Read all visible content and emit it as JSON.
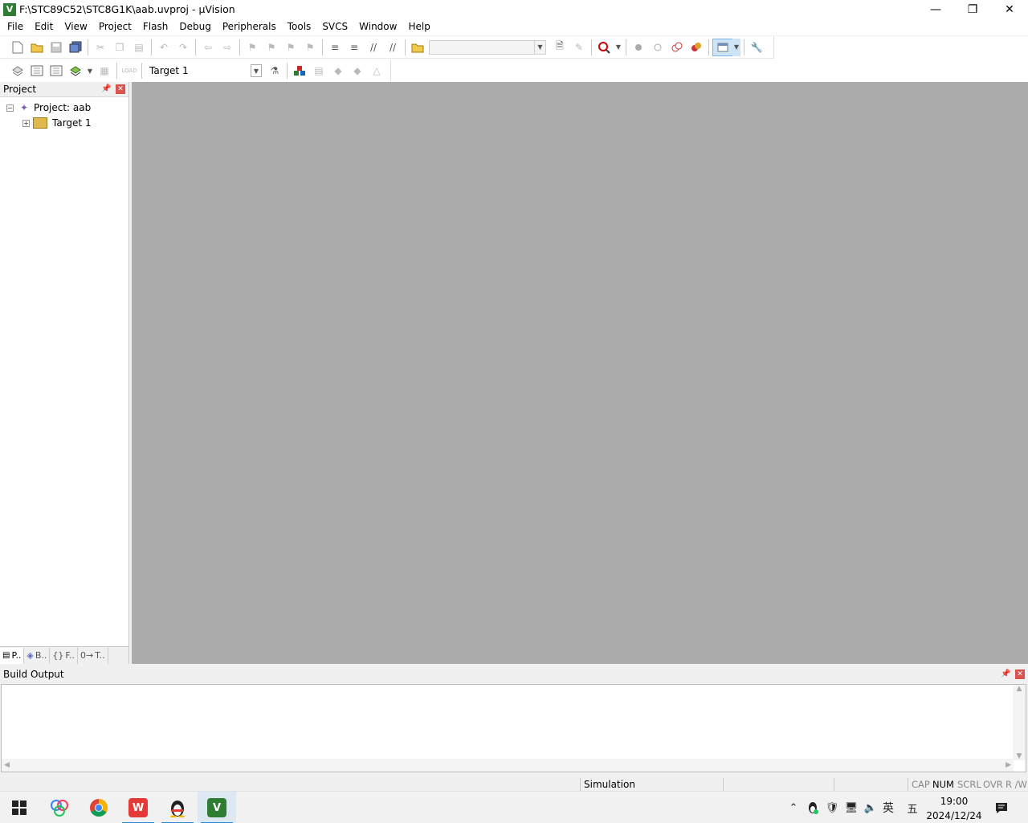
{
  "window": {
    "title": "F:\\STC89C52\\STC8G1K\\aab.uvproj - µVision",
    "app_icon_text": "V",
    "minimize_icon": "minimize-icon",
    "restore_icon": "restore-icon",
    "close_icon": "close-icon"
  },
  "menu": [
    "File",
    "Edit",
    "View",
    "Project",
    "Flash",
    "Debug",
    "Peripherals",
    "Tools",
    "SVCS",
    "Window",
    "Help"
  ],
  "toolbar2": {
    "target": "Target 1"
  },
  "project_panel": {
    "title": "Project",
    "root": "Project: aab",
    "child": "Target 1",
    "tabs": [
      "P..",
      "B..",
      "F..",
      "T.."
    ]
  },
  "build_output": {
    "title": "Build Output",
    "content": ""
  },
  "status": {
    "mode": "Simulation",
    "caps": "CAP",
    "num": "NUM",
    "scrl": "SCRL",
    "ovr": "OVR",
    "rw": "R /W"
  },
  "taskbar": {
    "ime": "英",
    "ime2": "五",
    "time": "19:00",
    "date": "2024/12/24"
  },
  "colors": {
    "workspace": "#ababab",
    "accent": "#2b88d8",
    "close_red": "#d9534f"
  }
}
